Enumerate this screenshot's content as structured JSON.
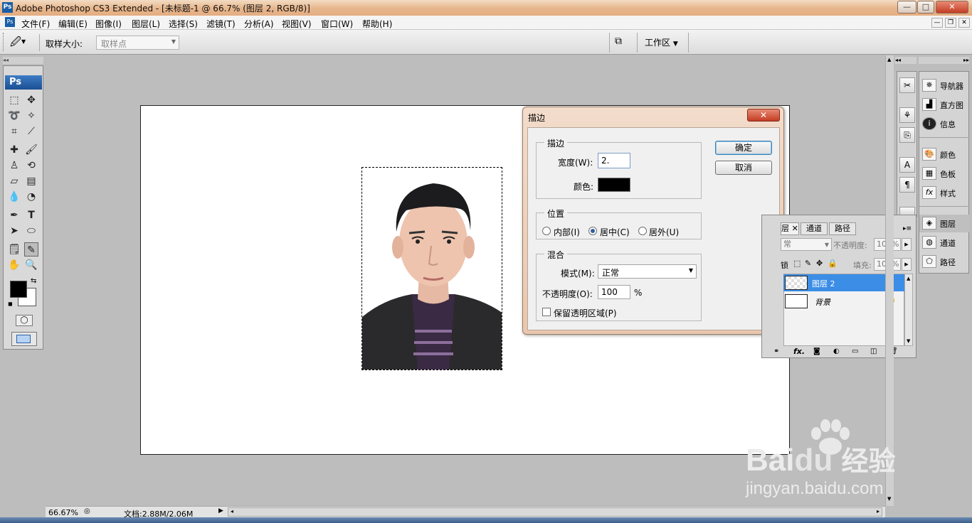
{
  "window": {
    "app_icon": "Ps",
    "title": "Adobe Photoshop CS3 Extended - [未标题-1 @ 66.7% (图层 2, RGB/8)]"
  },
  "menu": [
    "文件(F)",
    "编辑(E)",
    "图像(I)",
    "图层(L)",
    "选择(S)",
    "滤镜(T)",
    "分析(A)",
    "视图(V)",
    "窗口(W)",
    "帮助(H)"
  ],
  "options_bar": {
    "sample_size_label": "取样大小:",
    "sample_size_value": "取样点",
    "workspace_label": "工作区"
  },
  "toolbox": {
    "logo": "Ps"
  },
  "stroke_dialog": {
    "title": "描边",
    "group_stroke": "描边",
    "width_label": "宽度(W):",
    "width_value": "2.",
    "color_label": "颜色:",
    "stroke_color": "#000000",
    "group_location": "位置",
    "location_inside": "内部(I)",
    "location_center": "居中(C)",
    "location_outside": "居外(U)",
    "location_selected": "center",
    "group_blending": "混合",
    "mode_label": "模式(M):",
    "mode_value": "正常",
    "opacity_label": "不透明度(O):",
    "opacity_value": "100",
    "opacity_unit": "%",
    "preserve_transparency_label": "保留透明区域(P)",
    "ok_label": "确定",
    "cancel_label": "取消"
  },
  "right_panels": {
    "group1": [
      "导航器",
      "直方图",
      "信息"
    ],
    "group2": [
      "颜色",
      "色板",
      "样式"
    ],
    "group3": [
      "图层",
      "通道",
      "路径"
    ]
  },
  "layers_panel": {
    "tabs": [
      "层",
      "通道",
      "路径"
    ],
    "blend_partial": "常",
    "opacity_label": "不透明度:",
    "opacity_value": "100%",
    "lock_label": "锁",
    "fill_label": "填充:",
    "fill_value": "100%",
    "layers": [
      {
        "name": "图层 2",
        "selected": true
      },
      {
        "name": "背景",
        "selected": false
      }
    ],
    "footer_fx": "fx."
  },
  "status_bar": {
    "zoom": "66.67%",
    "doc_info": "文档:2.88M/2.06M"
  },
  "watermark": {
    "brand": "Bai",
    "brand2": "du",
    "cn": "经验",
    "url": "jingyan.baidu.com"
  },
  "colors": {
    "foreground": "#000000",
    "background": "#ffffff",
    "selected_layer": "#3b8de6"
  }
}
